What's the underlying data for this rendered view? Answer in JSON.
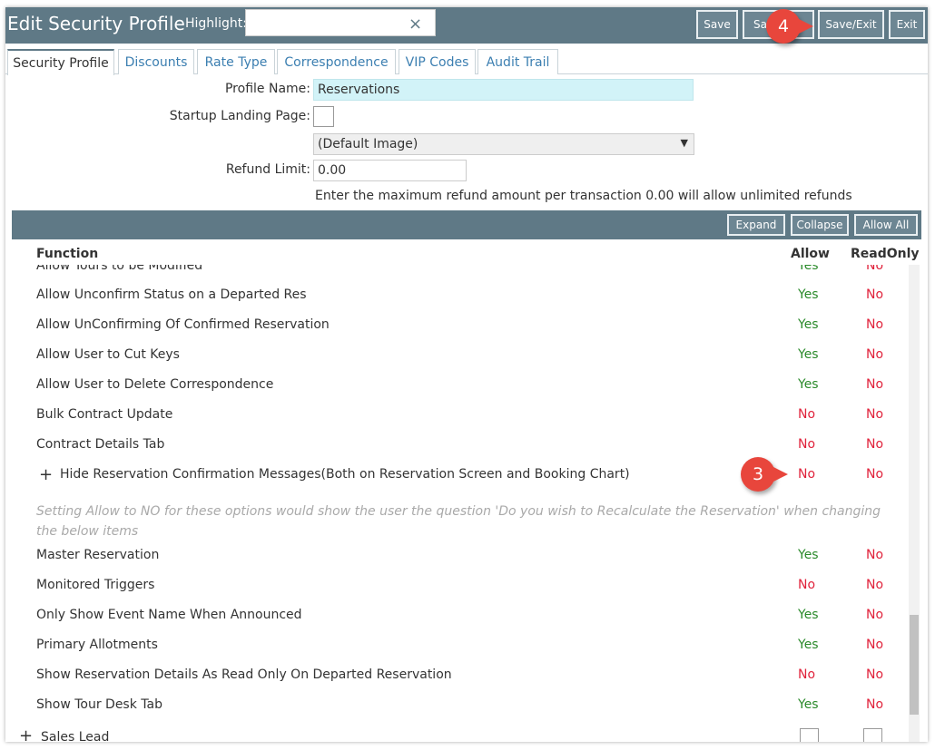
{
  "header": {
    "title": "Edit Security Profile",
    "highlight_label": "Highlight:",
    "highlight_value": "",
    "clear_icon": "×",
    "buttons": {
      "save": "Save",
      "save_close": "Sa",
      "save_exit": "Save/Exit",
      "exit": "Exit"
    }
  },
  "callouts": {
    "top": "4",
    "row": "3"
  },
  "tabs": [
    {
      "label": "Security Profile"
    },
    {
      "label": "Discounts"
    },
    {
      "label": "Rate Type"
    },
    {
      "label": "Correspondence"
    },
    {
      "label": "VIP Codes"
    },
    {
      "label": "Audit Trail"
    }
  ],
  "form": {
    "profile_name_label": "Profile Name:",
    "profile_name_value": "Reservations",
    "landing_label": "Startup Landing Page:",
    "image_select": "(Default Image)",
    "refund_label": "Refund Limit:",
    "refund_value": "0.00",
    "refund_hint": "Enter the maximum refund amount per transaction 0.00 will allow unlimited refunds"
  },
  "grid": {
    "buttons": {
      "expand": "Expand",
      "collapse": "Collapse",
      "allow_all": "Allow All"
    },
    "columns": {
      "function": "Function",
      "allow": "Allow",
      "readonly": "ReadOnly"
    },
    "partial_row": {
      "name": "Allow Tours to be Modified",
      "allow": "Yes",
      "readonly": "No"
    },
    "rows": [
      {
        "name": "Allow Unconfirm Status on a Departed Res",
        "allow": "Yes",
        "readonly": "No"
      },
      {
        "name": "Allow UnConfirming Of Confirmed Reservation",
        "allow": "Yes",
        "readonly": "No"
      },
      {
        "name": "Allow User to Cut Keys",
        "allow": "Yes",
        "readonly": "No"
      },
      {
        "name": "Allow User to Delete Correspondence",
        "allow": "Yes",
        "readonly": "No"
      },
      {
        "name": "Bulk Contract Update",
        "allow": "No",
        "readonly": "No"
      },
      {
        "name": "Contract Details Tab",
        "allow": "No",
        "readonly": "No"
      }
    ],
    "group_row": {
      "expander": "+",
      "name": "Hide Reservation Confirmation Messages(Both on Reservation Screen and Booking Chart)",
      "allow": "No",
      "readonly": "No"
    },
    "note": "Setting Allow to NO for these options would show the user the question 'Do you wish to Recalculate the Reservation' when changing the below items",
    "rows2": [
      {
        "name": "Master Reservation",
        "allow": "Yes",
        "readonly": "No"
      },
      {
        "name": "Monitored Triggers",
        "allow": "No",
        "readonly": "No"
      },
      {
        "name": "Only Show Event Name When Announced",
        "allow": "Yes",
        "readonly": "No"
      },
      {
        "name": "Primary Allotments",
        "allow": "Yes",
        "readonly": "No"
      },
      {
        "name": "Show Reservation Details As Read Only On Departed Reservation",
        "allow": "No",
        "readonly": "No"
      },
      {
        "name": "Show Tour Desk Tab",
        "allow": "Yes",
        "readonly": "No"
      }
    ],
    "sales_row": {
      "expander": "+",
      "name": "Sales Lead"
    }
  },
  "colors": {
    "header": "#5f7986",
    "yes": "#2a8a2a",
    "no": "#e0223b",
    "callout": "#e8463c",
    "profile_field": "#d2f3f8"
  }
}
